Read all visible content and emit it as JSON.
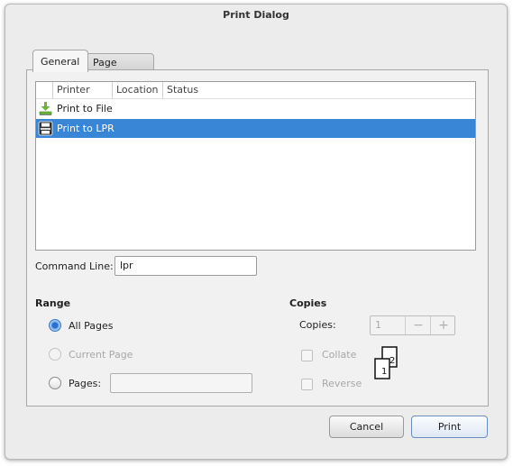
{
  "window": {
    "title": "Print Dialog"
  },
  "tabs": [
    {
      "label": "General",
      "active": true
    },
    {
      "label": "Page Setup",
      "active": false
    }
  ],
  "printer_list": {
    "columns": [
      "Printer",
      "Location",
      "Status"
    ],
    "rows": [
      {
        "name": "Print to File",
        "icon": "print-to-file-icon",
        "selected": false
      },
      {
        "name": "Print to LPR",
        "icon": "printer-icon",
        "selected": true
      }
    ]
  },
  "command_line": {
    "label": "Command Line:",
    "value": "lpr"
  },
  "range": {
    "title": "Range",
    "all_pages": "All Pages",
    "current_page": "Current Page",
    "pages": "Pages:",
    "pages_value": ""
  },
  "copies": {
    "title": "Copies",
    "copies_label": "Copies:",
    "value": "1",
    "minus": "−",
    "plus": "+",
    "collate": "Collate",
    "reverse": "Reverse",
    "collate_page_1": "1",
    "collate_page_2": "2"
  },
  "buttons": {
    "cancel": "Cancel",
    "print": "Print"
  },
  "colors": {
    "selection": "#3a86d6",
    "window_bg": "#ececec"
  }
}
